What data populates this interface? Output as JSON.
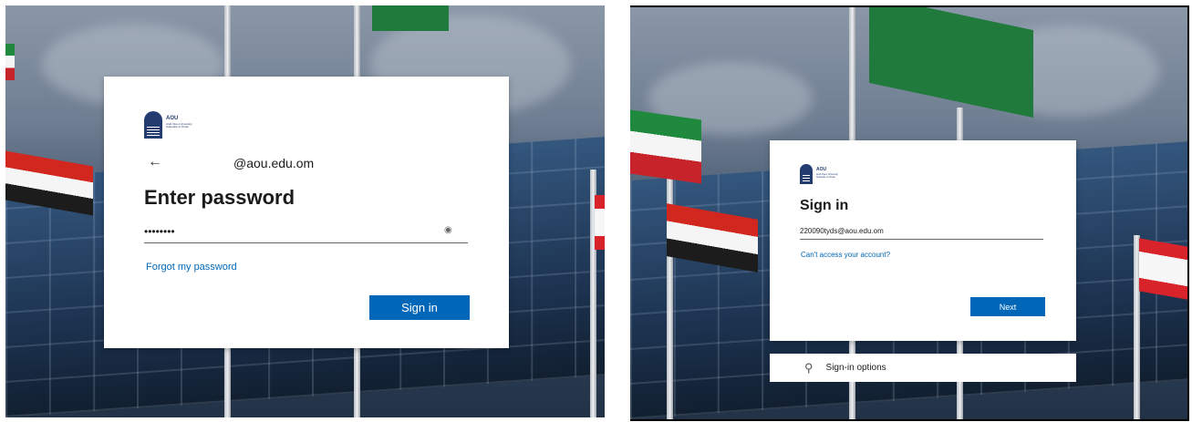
{
  "left_screen": {
    "logo": {
      "name": "AOU",
      "subtitle_lines": [
        "Arab Open University",
        "Sultanate of Oman"
      ]
    },
    "back_arrow": "←",
    "email": "@aou.edu.om",
    "heading": "Enter password",
    "password_value": "••••••••",
    "reveal_icon": "eye-icon",
    "forgot_link": "Forgot my password",
    "sign_in_button": "Sign in"
  },
  "right_screen": {
    "logo": {
      "name": "AOU",
      "subtitle_lines": [
        "Arab Open University",
        "Sultanate of Oman"
      ]
    },
    "heading": "Sign in",
    "email_value": "220090tyds@aou.edu.om",
    "access_link": "Can't access your account?",
    "next_button": "Next",
    "sign_in_options": {
      "icon": "key-icon",
      "label": "Sign-in options"
    }
  },
  "colors": {
    "accent": "#0067b8",
    "logo": "#233c70",
    "card": "#ffffff"
  }
}
